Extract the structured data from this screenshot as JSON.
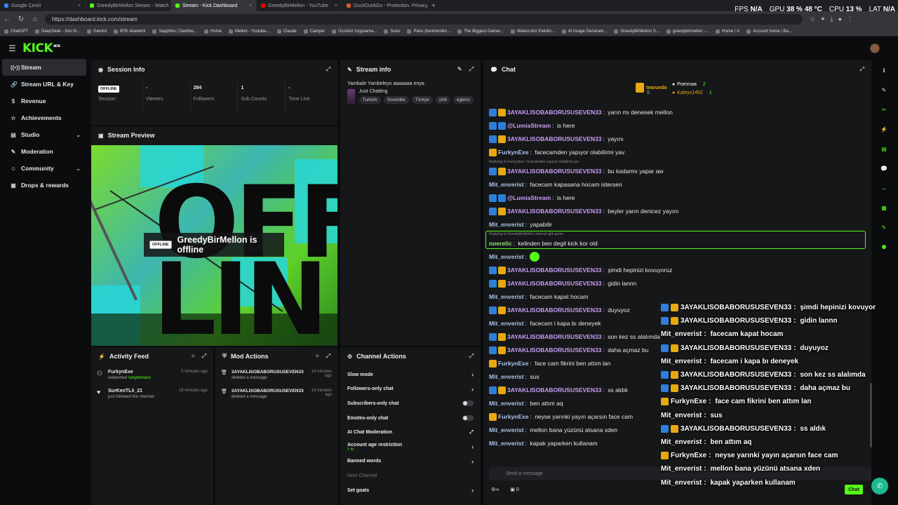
{
  "browser": {
    "tabs": [
      {
        "title": "Google Çeviri",
        "color": "#4285f4"
      },
      {
        "title": "GreedyBirMellon Stream - Watch",
        "color": "#53fc18"
      },
      {
        "title": "Stream - Kick Dashboard",
        "color": "#53fc18",
        "active": true
      },
      {
        "title": "GreedyBirMellon - YouTube",
        "color": "#ff0000"
      },
      {
        "title": "DuckDuckGo - Protection. Privacy",
        "color": "#de5833"
      }
    ],
    "url": "https://dashboard.kick.com/stream",
    "stats": {
      "fps_label": "FPS",
      "fps": "N/A",
      "gpu_label": "GPU",
      "gpu": "38 % 48 °C",
      "cpu_label": "CPU",
      "cpu": "13 %",
      "lat_label": "LAT",
      "lat": "N/A"
    },
    "bookmarks": [
      "ChatGPT",
      "DeepSeek - Into th...",
      "Gemini",
      "BTK Akademi",
      "Sapphire | Dashbo...",
      "Home",
      "Mellon - Youtube...",
      "Claude",
      "Camper",
      "Ücretsiz Uygulama...",
      "Suno",
      "Pano (bentrendim...",
      "The Biggest Gamer...",
      "Watercolor Paintin...",
      "AI Image Generato...",
      "GreedyBirMellon S...",
      "greedybirmellon -...",
      "Home / X",
      "Account home | Ba..."
    ]
  },
  "app": {
    "logo": "KICK",
    "logo_sup": "BETA"
  },
  "sidebar": {
    "items": [
      {
        "label": "Stream",
        "icon": "((•))",
        "active": true
      },
      {
        "label": "Stream URL & Key",
        "icon": "🔗"
      },
      {
        "label": "Revenue",
        "icon": "$"
      },
      {
        "label": "Achievements",
        "icon": "☆"
      },
      {
        "label": "Studio",
        "icon": "▤",
        "chevron": true
      },
      {
        "label": "Moderation",
        "icon": "✎"
      },
      {
        "label": "Community",
        "icon": "☺",
        "chevron": true
      },
      {
        "label": "Drops & rewards",
        "icon": "▣"
      }
    ]
  },
  "session": {
    "title": "Session Info",
    "cells": [
      {
        "value": "OFFLINE",
        "label": "Session"
      },
      {
        "value": "-",
        "label": "Viewers"
      },
      {
        "value": "284",
        "label": "Followers"
      },
      {
        "value": "1",
        "label": "Sub Counts"
      },
      {
        "value": "-",
        "label": "Time Live"
      }
    ]
  },
  "preview": {
    "title": "Stream Preview",
    "badge": "OFFLINE",
    "status": "GreedyBirMellon is offline",
    "big_line1": "OFF",
    "big_line2": "LIN"
  },
  "stream_info": {
    "title": "Stream info",
    "stream_title": "Yambale Yambeleyo aaaaaaa enya",
    "category": "Just Chatting",
    "tags": [
      "Turkish",
      "Soulslike",
      "Türkçe",
      "chill",
      "eglenc"
    ]
  },
  "activity": {
    "title": "Activity Feed",
    "items": [
      {
        "name": "FurkynExe",
        "sub": "redeemed",
        "hl": "sovyetmarsi",
        "time": "5 minutes ago"
      },
      {
        "name": "SurKenTLii_21",
        "sub": "just followed the channel",
        "hl": "",
        "time": "19 minutes ago"
      }
    ]
  },
  "mod": {
    "title": "Mod Actions",
    "items": [
      {
        "name": "3AYAKLISOBABORUSUSEVEN33",
        "sub": "deleted a message",
        "time": "14 minutes ago"
      },
      {
        "name": "3AYAKLISOBABORUSUSEVEN33",
        "sub": "deleted a message",
        "time": "14 minutes ago"
      }
    ]
  },
  "channel_actions": {
    "title": "Channel Actions",
    "rows": [
      {
        "label": "Slow mode",
        "type": "arrow"
      },
      {
        "label": "Followers-only chat",
        "type": "arrow"
      },
      {
        "label": "Subscribers-only chat",
        "type": "toggle"
      },
      {
        "label": "Emotes-only chat",
        "type": "toggle"
      },
      {
        "label": "AI Chat Moderation",
        "type": "ext"
      },
      {
        "label": "Account age restriction",
        "sub": "1 hr",
        "type": "arrow"
      },
      {
        "label": "Banned words",
        "type": "arrow"
      },
      {
        "label": "Host Channel",
        "type": "dim"
      },
      {
        "label": "Set goals",
        "type": "arrow"
      }
    ]
  },
  "chat": {
    "title": "Chat",
    "leaderboard": [
      {
        "name": "tearundo",
        "count": "5"
      },
      {
        "name": "Poexnaa",
        "count": "2"
      },
      {
        "name": "Kaleys1452",
        "count": "1"
      }
    ],
    "messages": [
      {
        "user": "3AYAKLISOBABORUSUSEVEN33",
        "text": "yarın mı denesek mellon",
        "color": "purple",
        "badges": [
          "b-blue",
          "b-gold"
        ]
      },
      {
        "user": "@LumiaStream",
        "text": "is here",
        "color": "purple",
        "badges": [
          "b-blue",
          "b-blue"
        ]
      },
      {
        "user": "3AYAKLISOBABORUSUSEVEN33",
        "text": "yayını",
        "color": "purple",
        "badges": [
          "b-blue",
          "b-gold"
        ]
      },
      {
        "user": "FurkynExe",
        "text": "facecamden yapıyor olabilirmi yav",
        "color": "blue",
        "badges": [
          "b-gold"
        ]
      },
      {
        "user": "3AYAKLISOBABORUSUSEVEN33",
        "text": "bu kadarmı yapar aw",
        "color": "purple",
        "badges": [
          "b-blue",
          "b-gold"
        ],
        "reply": "Replying to FurkynExe: facecamden yapıyor olabilirmi yav"
      },
      {
        "user": "Mit_enverist",
        "text": "facecam kapasana hocam istersen",
        "color": "blue",
        "badges": []
      },
      {
        "user": "@LumiaStream",
        "text": "is here",
        "color": "purple",
        "badges": [
          "b-blue",
          "b-blue"
        ]
      },
      {
        "user": "3AYAKLISOBABORUSUSEVEN33",
        "text": "beyler yarın denicez yayını",
        "color": "purple",
        "badges": [
          "b-blue",
          "b-gold"
        ]
      },
      {
        "user": "Mit_enverist",
        "text": "yapabilir",
        "color": "blue",
        "badges": []
      },
      {
        "user": "noerelic",
        "text": "kelinden ben degil kick kor old",
        "color": "green",
        "badges": [],
        "reply": "Replying to GreedyBirMellon: internet gitti game",
        "highlight": true
      },
      {
        "user": "Mit_enverist",
        "text": "",
        "color": "blue",
        "badges": [],
        "emote": true
      },
      {
        "user": "3AYAKLISOBABORUSUSEVEN33",
        "text": "şimdi hepinizi kovuyoruz",
        "color": "purple",
        "badges": [
          "b-blue",
          "b-gold"
        ]
      },
      {
        "user": "3AYAKLISOBABORUSUSEVEN33",
        "text": "gidin lannn",
        "color": "purple",
        "badges": [
          "b-blue",
          "b-gold"
        ]
      },
      {
        "user": "Mit_enverist",
        "text": "facecam kapat hocam",
        "color": "blue",
        "badges": []
      },
      {
        "user": "3AYAKLISOBABORUSUSEVEN33",
        "text": "duyuyoz",
        "color": "purple",
        "badges": [
          "b-blue",
          "b-gold"
        ]
      },
      {
        "user": "Mit_enverist",
        "text": "facecam i kapa bı deneyek",
        "color": "blue",
        "badges": []
      },
      {
        "user": "3AYAKLISOBABORUSUSEVEN33",
        "text": "son kez ss alalımda",
        "color": "purple",
        "badges": [
          "b-blue",
          "b-gold"
        ]
      },
      {
        "user": "3AYAKLISOBABORUSUSEVEN33",
        "text": "daha açmaz bu",
        "color": "purple",
        "badges": [
          "b-blue",
          "b-gold"
        ]
      },
      {
        "user": "FurkynExe",
        "text": "face cam fikrini ben attım lan",
        "color": "blue",
        "badges": [
          "b-gold"
        ]
      },
      {
        "user": "Mit_enverist",
        "text": "sus",
        "color": "blue",
        "badges": []
      },
      {
        "user": "3AYAKLISOBABORUSUSEVEN33",
        "text": "ss aldık",
        "color": "purple",
        "badges": [
          "b-blue",
          "b-gold"
        ]
      },
      {
        "user": "Mit_enverist",
        "text": "ben attım aq",
        "color": "blue",
        "badges": []
      },
      {
        "user": "FurkynExe",
        "text": "neyse yarınki yayın açarsın face cam",
        "color": "blue",
        "badges": [
          "b-gold"
        ]
      },
      {
        "user": "Mit_enverist",
        "text": "mellon bana yüzünü atsana xden",
        "color": "blue",
        "badges": []
      },
      {
        "user": "Mit_enverist",
        "text": "kapak yaparken kullanam",
        "color": "blue",
        "badges": []
      }
    ],
    "input_placeholder": "Send a message",
    "send_label": "Chat",
    "viewer_count": "0"
  },
  "overlay": [
    {
      "user": "3AYAKLISOBABORUSUSEVEN33",
      "text": "şimdi hepinizi kovuyoruz",
      "badges": [
        "b-blue",
        "b-gold"
      ]
    },
    {
      "user": "3AYAKLISOBABORUSUSEVEN33",
      "text": "gidin lannn",
      "badges": [
        "b-blue",
        "b-gold"
      ]
    },
    {
      "user": "Mit_enverist",
      "text": "facecam kapat hocam",
      "badges": []
    },
    {
      "user": "3AYAKLISOBABORUSUSEVEN33",
      "text": "duyuyoz",
      "badges": [
        "b-blue",
        "b-gold"
      ]
    },
    {
      "user": "Mit_enverist",
      "text": "facecam i kapa bı deneyek",
      "badges": []
    },
    {
      "user": "3AYAKLISOBABORUSUSEVEN33",
      "text": "son kez ss alalımda",
      "badges": [
        "b-blue",
        "b-gold"
      ]
    },
    {
      "user": "3AYAKLISOBABORUSUSEVEN33",
      "text": "daha açmaz bu",
      "badges": [
        "b-blue",
        "b-gold"
      ]
    },
    {
      "user": "FurkynExe",
      "text": "face cam fikrini ben attım lan",
      "badges": [
        "b-gold"
      ]
    },
    {
      "user": "Mit_enverist",
      "text": "sus",
      "badges": []
    },
    {
      "user": "3AYAKLISOBABORUSUSEVEN33",
      "text": "ss aldık",
      "badges": [
        "b-blue",
        "b-gold"
      ]
    },
    {
      "user": "Mit_enverist",
      "text": "ben attım aq",
      "badges": []
    },
    {
      "user": "FurkynExe",
      "text": "neyse yarınki yayın açarsın face cam",
      "badges": [
        "b-gold"
      ]
    },
    {
      "user": "Mit_enverist",
      "text": "mellon bana yüzünü atsana xden",
      "badges": []
    },
    {
      "user": "Mit_enverist",
      "text": "kapak yaparken kullanam",
      "badges": []
    }
  ],
  "colors": {
    "brand": "#53fc18",
    "panel": "#161719",
    "bg": "#0b0c0e"
  }
}
